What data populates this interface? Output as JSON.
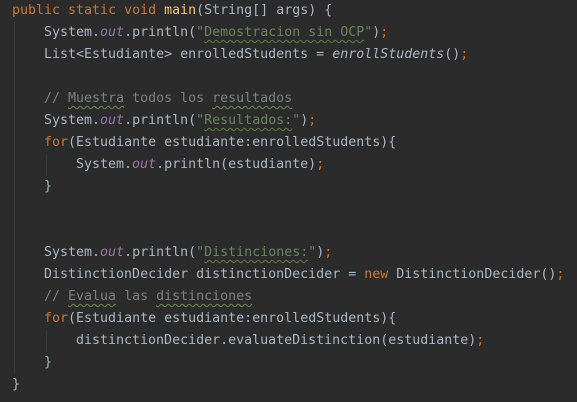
{
  "code": {
    "l1": {
      "kw1": "public static void ",
      "method": "main",
      "rest": "(String[] args) {"
    },
    "l2": {
      "obj": "System.",
      "field": "out",
      "call": ".println(",
      "q1": "\"",
      "str": "Demostracion sin OCP",
      "q2": "\"",
      "close": ")",
      "semi": ";"
    },
    "l3": {
      "decl": "List<Estudiante> enrolledStudents = ",
      "call": "enrollStudents",
      "close": "()",
      "semi": ";"
    },
    "l5": {
      "prefix": "// ",
      "w1": "Muestra",
      "mid": " todos los ",
      "w2": "resultados"
    },
    "l6": {
      "obj": "System.",
      "field": "out",
      "call": ".println(",
      "q1": "\"",
      "str": "Resultados:",
      "q2": "\"",
      "close": ")",
      "semi": ";"
    },
    "l7": {
      "kw": "for",
      "rest": "(Estudiante estudiante:enrolledStudents){"
    },
    "l8": {
      "obj": "System.",
      "field": "out",
      "call": ".println(estudiante)",
      "semi": ";"
    },
    "l9": {
      "brace": "}"
    },
    "l12": {
      "obj": "System.",
      "field": "out",
      "call": ".println(",
      "q1": "\"",
      "str": "Distinciones:",
      "q2": "\"",
      "close": ")",
      "semi": ";"
    },
    "l13": {
      "decl": "DistinctionDecider distinctionDecider = ",
      "kw": "new",
      "ctor": " DistinctionDecider()",
      "semi": ";"
    },
    "l14": {
      "prefix": "// ",
      "w1": "Evalua",
      "mid": " las ",
      "w2": "distinciones"
    },
    "l15": {
      "kw": "for",
      "rest": "(Estudiante estudiante:enrolledStudents){"
    },
    "l16": {
      "call": "distinctionDecider.evaluateDistinction(estudiante)",
      "semi": ";"
    },
    "l17": {
      "brace": "}"
    },
    "l18": {
      "brace": "}"
    }
  },
  "colors": {
    "background": "#2b2b2b",
    "text": "#a9b7c6",
    "keyword": "#cc7832",
    "method_decl": "#ffc66d",
    "string": "#6a8759",
    "static_field": "#9876aa",
    "comment": "#808080"
  }
}
